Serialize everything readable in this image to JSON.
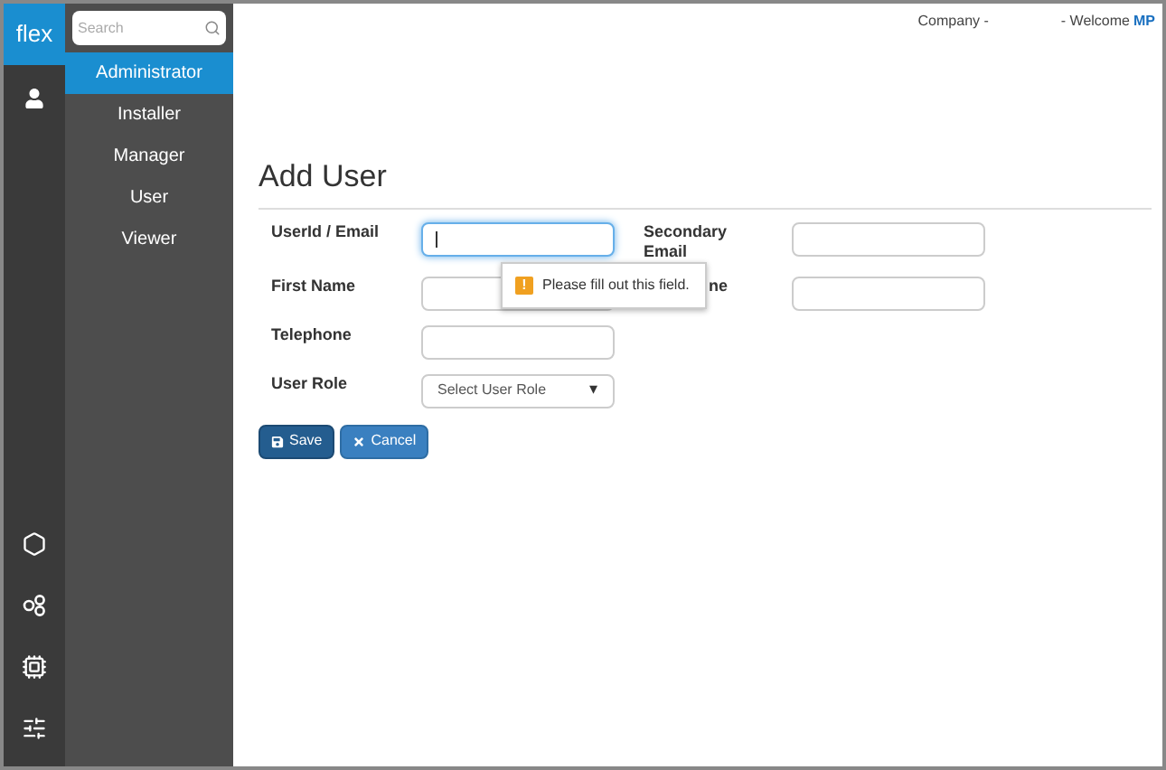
{
  "logo": "flex",
  "search": {
    "placeholder": "Search"
  },
  "nav_items": [
    {
      "label": "Administrator",
      "selected": true
    },
    {
      "label": "Installer",
      "selected": false
    },
    {
      "label": "Manager",
      "selected": false
    },
    {
      "label": "User",
      "selected": false
    },
    {
      "label": "Viewer",
      "selected": false
    }
  ],
  "header": {
    "company": "Company -",
    "welcome": "- Welcome",
    "user": "MP"
  },
  "title": "Add User",
  "form_rows": [
    {
      "fields": [
        {
          "label": "UserId / Email",
          "kind": "text",
          "focused": true,
          "covered": false
        },
        {
          "label": "Secondary Email",
          "kind": "text",
          "focused": false,
          "covered": false
        }
      ]
    },
    {
      "fields": [
        {
          "label": "First Name",
          "kind": "text",
          "focused": false,
          "covered": false
        },
        {
          "label": "ne",
          "kind": "text",
          "focused": false,
          "covered": true
        }
      ]
    },
    {
      "fields": [
        {
          "label": "Telephone",
          "kind": "text",
          "focused": false,
          "covered": false
        }
      ]
    },
    {
      "fields": [
        {
          "label": "User Role",
          "kind": "select",
          "placeholder": "Select User Role",
          "caret": "▾",
          "focused": false,
          "covered": false
        }
      ]
    }
  ],
  "tooltip": {
    "icon": "!",
    "text": "Please fill out this field."
  },
  "buttons": [
    {
      "label": "Save",
      "kind": "save"
    },
    {
      "label": "Cancel",
      "kind": "cancel"
    }
  ]
}
